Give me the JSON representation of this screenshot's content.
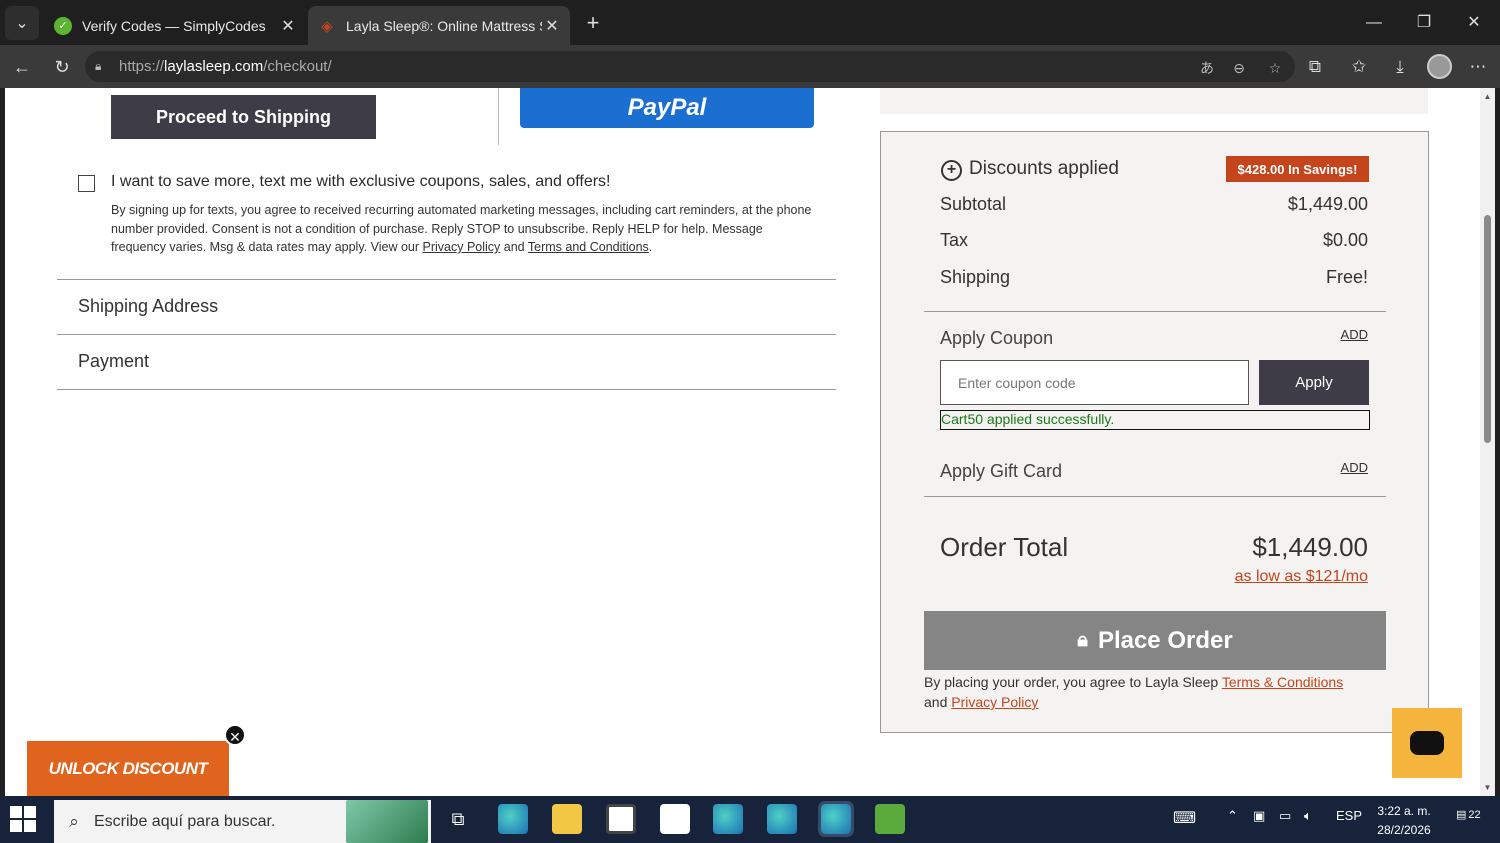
{
  "browser": {
    "tabs": [
      {
        "title": "Verify Codes — SimplyCodes",
        "active": false,
        "favicon_color": "#5bb531"
      },
      {
        "title": "Layla Sleep®: Online Mattress Stor",
        "active": true,
        "favicon_color": "#c4451c"
      }
    ],
    "url_prefix": "https://",
    "url_host": "laylasleep.com",
    "url_path": "/checkout/"
  },
  "left": {
    "proceed_label": "Proceed to Shipping",
    "paypal_label": "PayPal",
    "sms_label": "I want to save more, text me with exclusive coupons, sales, and offers!",
    "sms_fine": "By signing up for texts, you agree to received recurring automated marketing messages, including cart reminders, at the phone number provided. Consent is not a condition of purchase. Reply STOP to unsubscribe. Reply HELP for help. Message frequency varies. Msg & data rates may apply. View our",
    "privacy_link": "Privacy Policy",
    "and_text": "and",
    "terms_link": "Terms and Conditions",
    "shipping_section": "Shipping Address",
    "payment_section": "Payment"
  },
  "summary": {
    "discounts_label": "Discounts applied",
    "savings_badge": "$428.00 In Savings!",
    "subtotal_label": "Subtotal",
    "subtotal_value": "$1,449.00",
    "tax_label": "Tax",
    "tax_value": "$0.00",
    "shipping_label": "Shipping",
    "shipping_value": "Free!",
    "coupon_label": "Apply Coupon",
    "coupon_add": "ADD",
    "coupon_placeholder": "Enter coupon code",
    "apply_label": "Apply",
    "coupon_success": "Cart50 applied successfully.",
    "gift_label": "Apply Gift Card",
    "gift_add": "ADD",
    "order_total_label": "Order Total",
    "order_total_value": "$1,449.00",
    "as_low_as": "as low as $121/mo",
    "place_order_label": "Place Order",
    "legal_text": "By placing your order, you agree to Layla Sleep",
    "legal_terms": "Terms & Conditions",
    "legal_and": "and",
    "legal_privacy": "Privacy Policy"
  },
  "popups": {
    "unlock_label": "UNLOCK DISCOUNT"
  },
  "taskbar": {
    "search_placeholder": "Escribe aquí para buscar.",
    "lang": "ESP",
    "time": "3:22 a. m.",
    "date": "28/2/2026",
    "notifications": "22"
  },
  "colors": {
    "accent": "#c4451c",
    "dark_button": "#3d3c47",
    "paypal": "#1a6fd1",
    "success": "#1a7a1a"
  }
}
